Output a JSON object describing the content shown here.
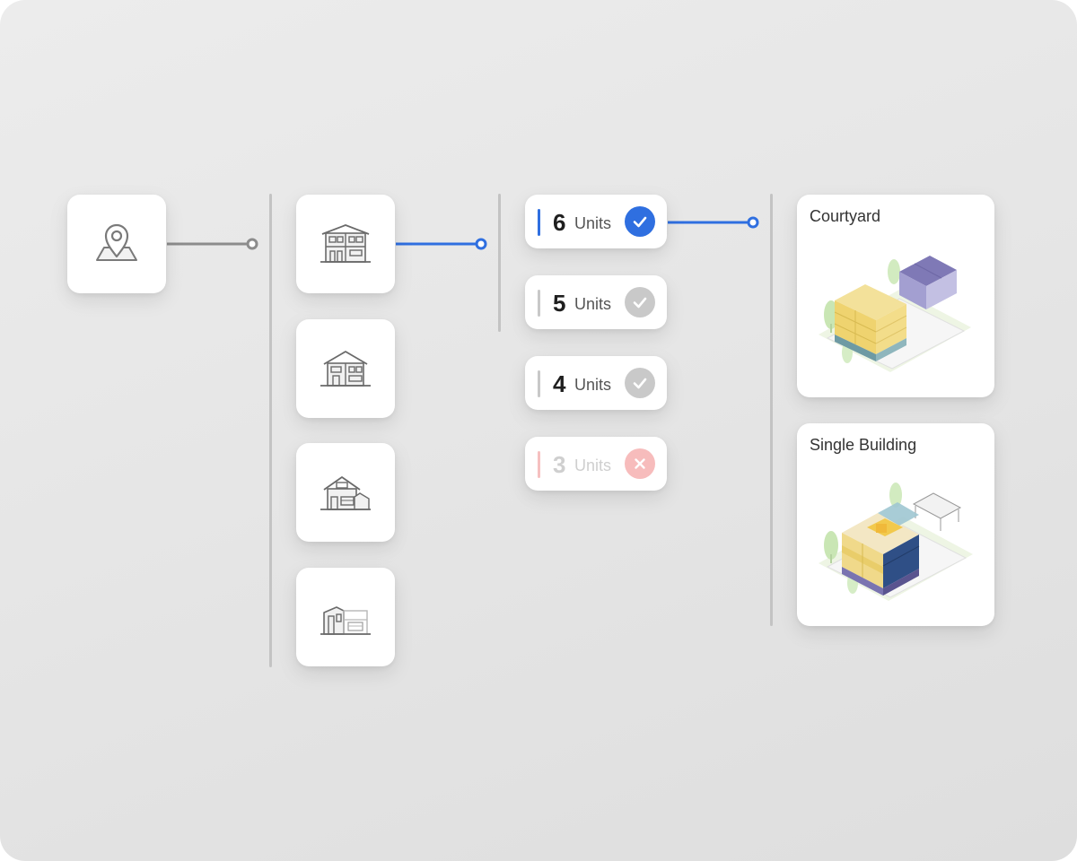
{
  "colors": {
    "accent": "#2f6fe0",
    "connector_gray": "#8c8c8c",
    "check_gray": "#c6c6c6",
    "error_pink": "#f6b6b6",
    "divider": "#c3c3c3"
  },
  "units": [
    {
      "number": "6",
      "label": "Units",
      "status": "selected"
    },
    {
      "number": "5",
      "label": "Units",
      "status": "available"
    },
    {
      "number": "4",
      "label": "Units",
      "status": "available"
    },
    {
      "number": "3",
      "label": "Units",
      "status": "unavailable"
    }
  ],
  "layouts": [
    {
      "title": "Courtyard"
    },
    {
      "title": "Single Building"
    }
  ],
  "icons": {
    "location": "map-pin-icon",
    "building_types": [
      "multi-storey-house-icon",
      "two-storey-house-icon",
      "garage-house-icon",
      "modern-house-icon"
    ]
  }
}
